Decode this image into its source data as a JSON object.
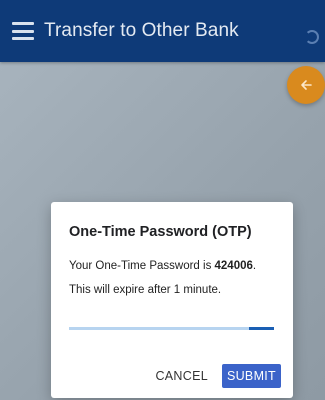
{
  "app_bar": {
    "title": "Transfer to Other Bank",
    "menu_icon": "hamburger-menu-icon",
    "loading_icon": "spinner-icon",
    "bg_color": "#0e3a78"
  },
  "fab": {
    "icon": "arrow-left-icon",
    "color": "#d98a1e"
  },
  "otp_dialog": {
    "title": "One-Time Password (OTP)",
    "message_prefix": "Your One-Time Password is ",
    "otp_code": "424006",
    "message_suffix": ".",
    "expiry_text": "This will expire after 1 minute.",
    "progress_remaining": 0.12,
    "cancel_label": "CANCEL",
    "submit_label": "SUBMIT",
    "submit_color": "#3b63c9"
  }
}
